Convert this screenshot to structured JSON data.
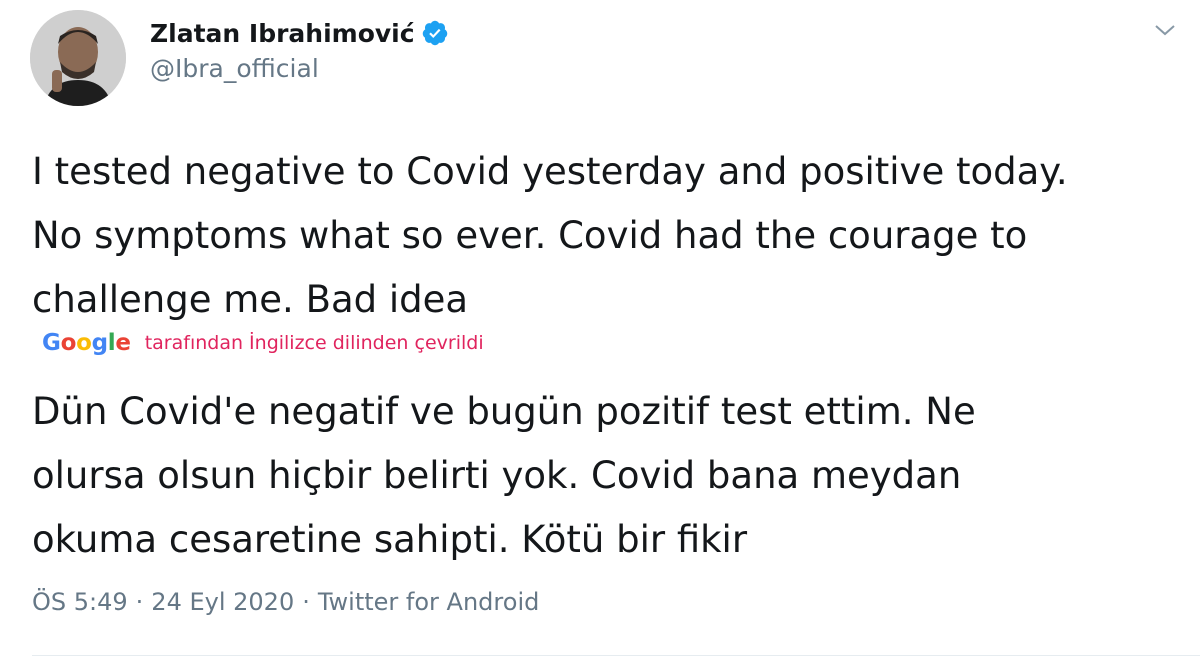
{
  "author": {
    "display_name": "Zlatan Ibrahimović",
    "handle": "@Ibra_official",
    "verified": true
  },
  "tweet": {
    "text": "I tested negative to Covid yesterday and positive today.\nNo symptoms what so ever. Covid had the courage to\nchallenge me. Bad idea"
  },
  "translation": {
    "provider": "Google",
    "note": "tarafından İngilizce dilinden çevrildi",
    "text": "Dün Covid'e negatif ve bugün pozitif test ettim. Ne\nolursa olsun hiçbir belirti yok. Covid bana meydan\nokuma cesaretine sahipti. Kötü bir fikir"
  },
  "meta": {
    "time": "ÖS 5:49",
    "separator": "·",
    "date": "24 Eyl 2020",
    "source": "Twitter for Android"
  },
  "icons": {
    "verified": "verified-badge-icon",
    "caret": "chevron-down-icon"
  },
  "colors": {
    "verified_blue": "#1DA1F2",
    "secondary_text": "#657786",
    "translation_note": "#e0245e"
  }
}
